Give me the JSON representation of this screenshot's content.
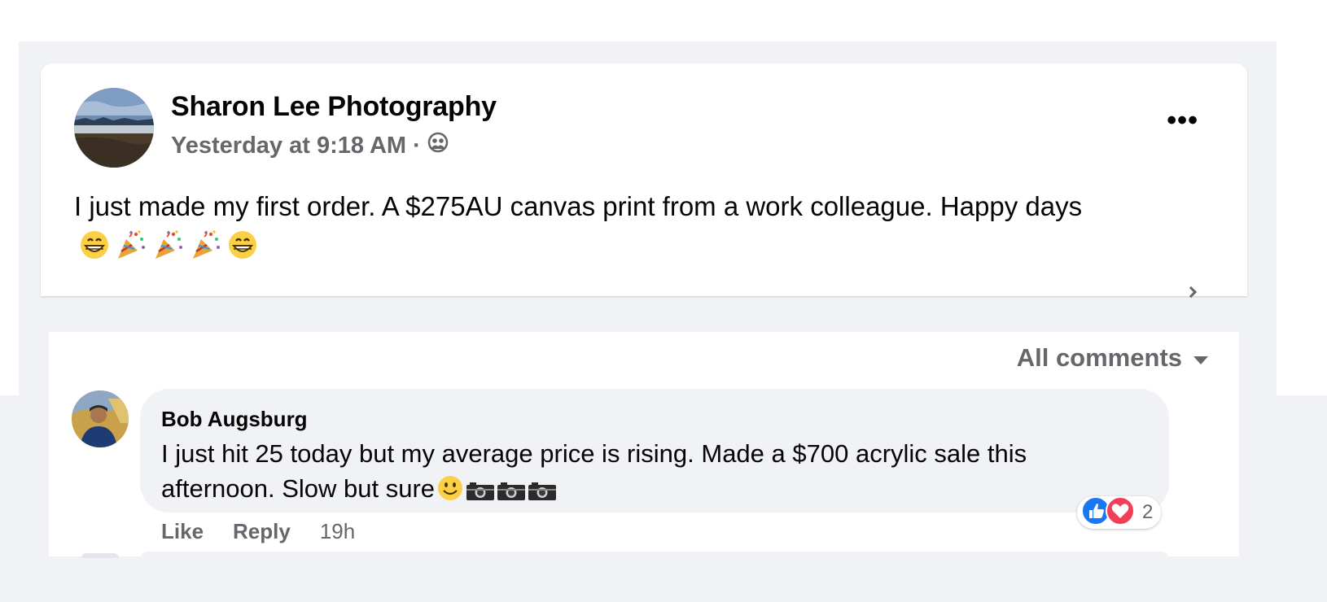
{
  "post": {
    "author": "Sharon Lee Photography",
    "timestamp": "Yesterday at 9:18 AM",
    "separator": "·",
    "audience_icon": "friends-icon",
    "text": "I just made my first order. A $275AU canvas print from a work colleague. Happy days",
    "emojis": [
      "grinning-face",
      "party-popper",
      "party-popper",
      "party-popper",
      "grinning-face"
    ],
    "more_label": "•••"
  },
  "comments": {
    "sort_label": "All comments",
    "items": [
      {
        "author": "Bob Augsburg",
        "text": "I just hit 25 today but my average price is rising. Made a $700 acrylic sale this afternoon. Slow but sure",
        "emojis": [
          "slightly-smiling-face",
          "camera",
          "camera",
          "camera"
        ],
        "like_label": "Like",
        "reply_label": "Reply",
        "time": "19h",
        "reactions": [
          "like-icon",
          "love-icon"
        ],
        "reaction_count": "2"
      }
    ]
  },
  "colors": {
    "background": "#f0f2f5",
    "card": "#ffffff",
    "secondary_text": "#65676b",
    "like_blue": "#1877f2",
    "love_red": "#f33e58"
  }
}
